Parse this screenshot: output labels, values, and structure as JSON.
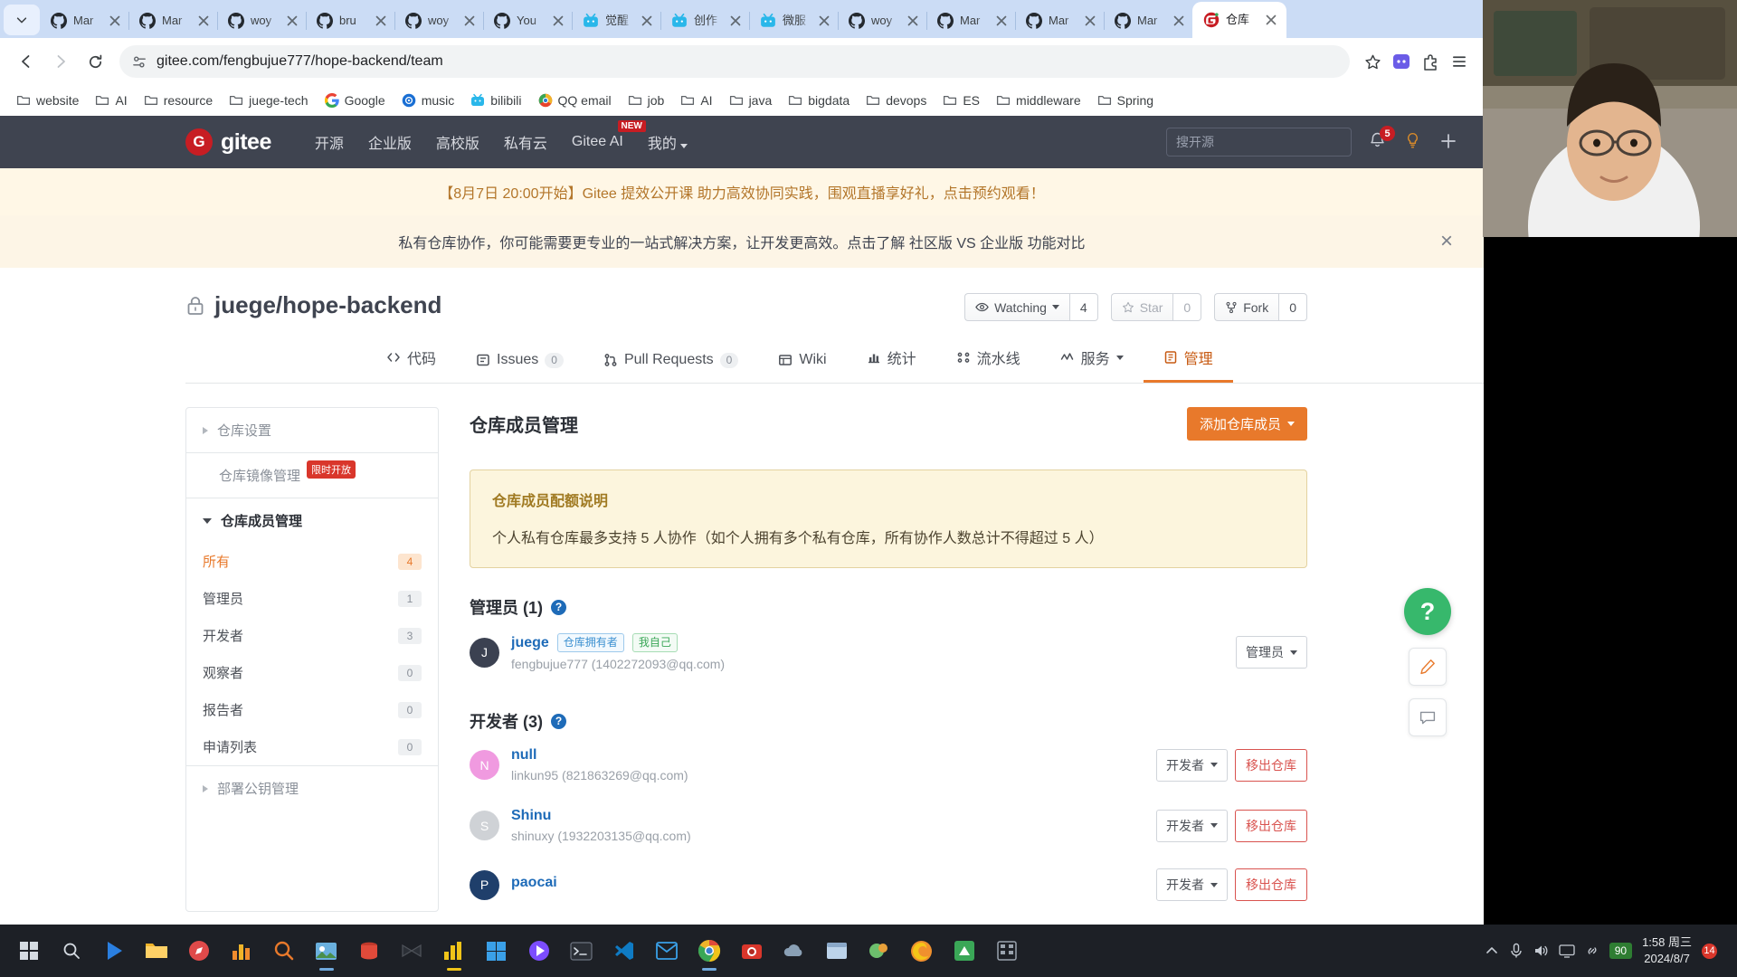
{
  "browser": {
    "tabs": [
      {
        "label": "Mar",
        "favicon": "github-icon",
        "active": false
      },
      {
        "label": "Mar",
        "favicon": "github-icon",
        "active": false
      },
      {
        "label": "woy",
        "favicon": "github-icon",
        "active": false
      },
      {
        "label": "bru",
        "favicon": "github-icon",
        "active": false
      },
      {
        "label": "woy",
        "favicon": "github-icon",
        "active": false
      },
      {
        "label": "You",
        "favicon": "github-icon",
        "active": false
      },
      {
        "label": "觉醒",
        "favicon": "bilibili-icon",
        "active": false
      },
      {
        "label": "创作",
        "favicon": "bilibili-icon",
        "active": false
      },
      {
        "label": "微服",
        "favicon": "bilibili-icon",
        "active": false
      },
      {
        "label": "woy",
        "favicon": "github-icon",
        "active": false
      },
      {
        "label": "Mar",
        "favicon": "github-icon",
        "active": false
      },
      {
        "label": "Mar",
        "favicon": "github-icon",
        "active": false
      },
      {
        "label": "Mar",
        "favicon": "github-icon",
        "active": false
      },
      {
        "label": "仓库",
        "favicon": "gitee-icon",
        "active": true
      }
    ],
    "url": "gitee.com/fengbujue777/hope-backend/team",
    "bookmarks": [
      {
        "label": "website",
        "icon": "folder-icon"
      },
      {
        "label": "AI",
        "icon": "folder-icon"
      },
      {
        "label": "resource",
        "icon": "folder-icon"
      },
      {
        "label": "juege-tech",
        "icon": "folder-icon"
      },
      {
        "label": "Google",
        "icon": "google-icon"
      },
      {
        "label": "music",
        "icon": "music-icon"
      },
      {
        "label": "bilibili",
        "icon": "bilibili-icon"
      },
      {
        "label": "QQ email",
        "icon": "qq-icon"
      },
      {
        "label": "job",
        "icon": "folder-icon"
      },
      {
        "label": "AI",
        "icon": "folder-icon"
      },
      {
        "label": "java",
        "icon": "folder-icon"
      },
      {
        "label": "bigdata",
        "icon": "folder-icon"
      },
      {
        "label": "devops",
        "icon": "folder-icon"
      },
      {
        "label": "ES",
        "icon": "folder-icon"
      },
      {
        "label": "middleware",
        "icon": "folder-icon"
      },
      {
        "label": "Spring",
        "icon": "folder-icon"
      }
    ]
  },
  "gitee": {
    "logo_text": "gitee",
    "logo_mark": "G",
    "nav": [
      {
        "label": "开源",
        "badge": null
      },
      {
        "label": "企业版",
        "badge": null
      },
      {
        "label": "高校版",
        "badge": null
      },
      {
        "label": "私有云",
        "badge": null
      },
      {
        "label": "Gitee AI",
        "badge": "NEW"
      },
      {
        "label": "我的",
        "badge": null,
        "caret": true
      }
    ],
    "search_placeholder": "搜开源",
    "notification_count": "5"
  },
  "banners": {
    "promo": "【8月7日 20:00开始】Gitee 提效公开课 助力高效协同实践，围观直播享好礼，点击预约观看！",
    "upgrade": "私有仓库协作，你可能需要更专业的一站式解决方案，让开发更高效。点击了解 社区版 VS 企业版 功能对比",
    "close_label": "×"
  },
  "repo": {
    "name": "juege/hope-backend",
    "lock_icon": "lock-icon",
    "watching_label": "Watching",
    "watching_count": "4",
    "star_label": "Star",
    "star_count": "0",
    "fork_label": "Fork",
    "fork_count": "0",
    "tabs": [
      {
        "label": "代码",
        "icon": "code-icon",
        "count": null,
        "active": false
      },
      {
        "label": "Issues",
        "icon": "issue-icon",
        "count": "0",
        "active": false
      },
      {
        "label": "Pull Requests",
        "icon": "pr-icon",
        "count": "0",
        "active": false
      },
      {
        "label": "Wiki",
        "icon": "wiki-icon",
        "count": null,
        "active": false
      },
      {
        "label": "统计",
        "icon": "chart-icon",
        "count": null,
        "active": false
      },
      {
        "label": "流水线",
        "icon": "pipeline-icon",
        "count": null,
        "active": false
      },
      {
        "label": "服务",
        "icon": "service-icon",
        "count": null,
        "active": false,
        "caret": true
      },
      {
        "label": "管理",
        "icon": "manage-icon",
        "count": null,
        "active": true
      }
    ]
  },
  "sidebar": {
    "repo_settings": "仓库设置",
    "mirror_management": "仓库镜像管理",
    "mirror_badge": "限时开放",
    "member_management": "仓库成员管理",
    "deploy_keys": "部署公钥管理",
    "items": [
      {
        "label": "所有",
        "count": "4",
        "selected": true
      },
      {
        "label": "管理员",
        "count": "1",
        "selected": false
      },
      {
        "label": "开发者",
        "count": "3",
        "selected": false
      },
      {
        "label": "观察者",
        "count": "0",
        "selected": false
      },
      {
        "label": "报告者",
        "count": "0",
        "selected": false
      },
      {
        "label": "申请列表",
        "count": "0",
        "selected": false
      }
    ]
  },
  "main": {
    "title": "仓库成员管理",
    "add_member_button": "添加仓库成员",
    "notice_title": "仓库成员配额说明",
    "notice_body": "个人私有仓库最多支持 5 人协作（如个人拥有多个私有仓库，所有协作人数总计不得超过 5 人）",
    "groups": [
      {
        "title": "管理员 (1)",
        "help_icon": "question-icon",
        "members": [
          {
            "name": "juege",
            "initial": "J",
            "avatar_color": "#3b4151",
            "tags": [
              {
                "text": "仓库拥有者",
                "kind": "owner"
              },
              {
                "text": "我自己",
                "kind": "self"
              }
            ],
            "detail": "fengbujue777 (1402272093@qq.com)",
            "role": "管理员",
            "remove_label": null
          }
        ]
      },
      {
        "title": "开发者 (3)",
        "help_icon": "question-icon",
        "members": [
          {
            "name": "null",
            "initial": "N",
            "avatar_color": "#f09ae0",
            "tags": [],
            "detail": "linkun95 (821863269@qq.com)",
            "role": "开发者",
            "remove_label": "移出仓库"
          },
          {
            "name": "Shinu",
            "initial": "S",
            "avatar_color": "#cfd2d6",
            "tags": [],
            "detail": "shinuxy (1932203135@qq.com)",
            "role": "开发者",
            "remove_label": "移出仓库"
          },
          {
            "name": "paocai",
            "initial": "P",
            "avatar_color": "#1f3f6b",
            "tags": [],
            "detail": "",
            "role": "开发者",
            "remove_label": "移出仓库"
          }
        ]
      }
    ]
  },
  "float_widgets": {
    "help": "?",
    "edit_icon": "pencil-icon",
    "feedback_icon": "comment-icon"
  },
  "taskbar": {
    "battery": "90",
    "time": "1:58 周三",
    "date": "2024/8/7",
    "notify_count": "14"
  }
}
